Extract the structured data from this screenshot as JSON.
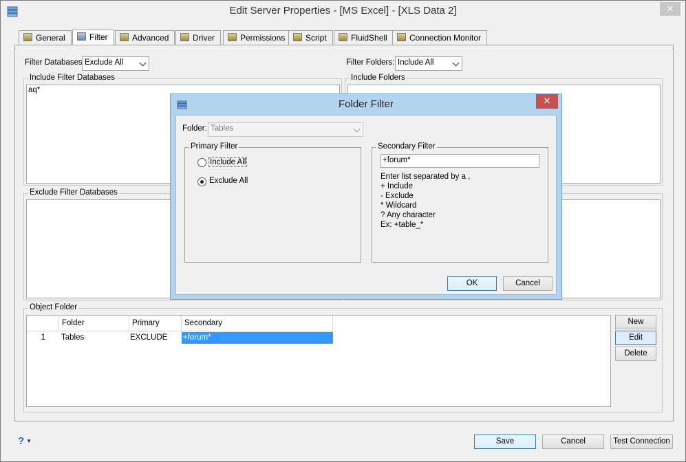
{
  "window": {
    "title": "Edit Server Properties - [MS Excel] - [XLS Data 2]",
    "close_glyph": "✕"
  },
  "tabs": [
    {
      "label": "General",
      "icon": "general-icon"
    },
    {
      "label": "Filter",
      "icon": "filter-icon",
      "active": true
    },
    {
      "label": "Advanced",
      "icon": "advanced-icon"
    },
    {
      "label": "Driver",
      "icon": "driver-icon"
    },
    {
      "label": "Permissions",
      "icon": "permissions-icon"
    },
    {
      "label": "Script",
      "icon": "script-icon"
    },
    {
      "label": "FluidShell",
      "icon": "fluidshell-icon"
    },
    {
      "label": "Connection Monitor",
      "icon": "connection-monitor-icon"
    }
  ],
  "filter": {
    "databases_label": "Filter Databases",
    "databases_value": "Exclude All",
    "folders_label": "Filter Folders:",
    "folders_value": "Include All",
    "include_db_legend": "Include Filter Databases",
    "include_db_text": "aq*",
    "include_folders_legend": "Include Folders",
    "exclude_db_legend": "Exclude Filter Databases"
  },
  "object_folder": {
    "legend": "Object Folder",
    "columns": [
      "Folder",
      "Primary",
      "Secondary"
    ],
    "rows": [
      {
        "num": "1",
        "folder": "Tables",
        "primary": "EXCLUDE",
        "secondary": "+forum*"
      }
    ],
    "new_label": "New",
    "edit_label": "Edit",
    "delete_label": "Delete"
  },
  "footer": {
    "help_glyph": "?",
    "save_label": "Save",
    "cancel_label": "Cancel",
    "test_label": "Test Connection"
  },
  "dialog": {
    "title": "Folder Filter",
    "close_glyph": "✕",
    "folder_label": "Folder:",
    "folder_value": "Tables",
    "primary_legend": "Primary Filter",
    "include_all_label": "Include All",
    "exclude_all_label": "Exclude All",
    "selected_primary": "Exclude All",
    "secondary_legend": "Secondary Filter",
    "secondary_value": "+forum*",
    "help_lines": [
      "Enter list separated by a ,",
      "+ Include",
      "- Exclude",
      "* Wildcard",
      "? Any character",
      "Ex: +table_*"
    ],
    "ok_label": "OK",
    "cancel_label": "Cancel"
  },
  "colors": {
    "selection": "#3399ff",
    "dialog_frame": "#b3d4ef",
    "close_red": "#c75050"
  }
}
